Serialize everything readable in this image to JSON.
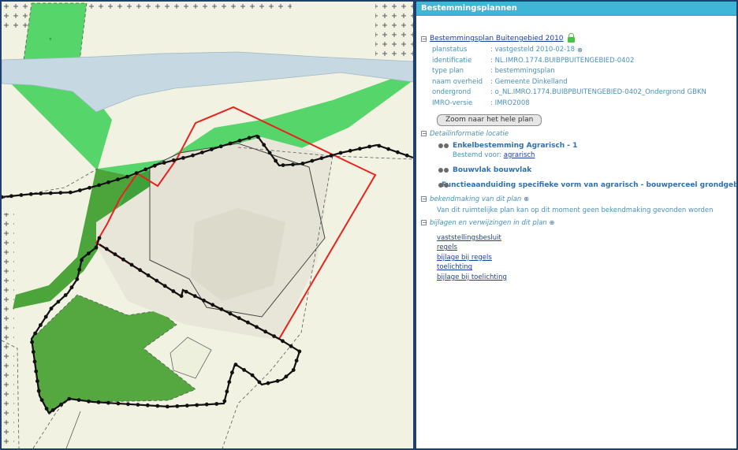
{
  "panel": {
    "header": "Bestemmingsplannen",
    "plan_title": "Bestemmingsplan Buitengebied 2010",
    "fields": [
      {
        "key": "planstatus",
        "value": ": vastgesteld 2010-02-18"
      },
      {
        "key": "identificatie",
        "value": ": NL.IMRO.1774.BUIBPBUITENGEBIED-0402"
      },
      {
        "key": "type plan",
        "value": ": bestemmingsplan"
      },
      {
        "key": "naam overheid",
        "value": ": Gemeente Dinkelland"
      },
      {
        "key": "ondergrond",
        "value": ": o_NL.IMRO.1774.BUIBPBUITENGEBIED-0402_Ondergrond GBKN"
      },
      {
        "key": "IMRO-versie",
        "value": ": IMRO2008"
      }
    ],
    "zoom_button": "Zoom naar het hele plan",
    "detail_head": "Detailinformatie locatie",
    "detail_items": [
      {
        "label": "Enkelbestemming Agrarisch - 1"
      },
      {
        "label": "Bouwvlak bouwvlak"
      },
      {
        "label": "Functieaanduiding specifieke vorm van agrarisch - bouwperceel grondgebonden"
      }
    ],
    "bestemd_label": "Bestemd voor:",
    "bestemd_link": "agrarisch",
    "bekendmaking_head": "bekendmaking van dit plan",
    "bekendmaking_text": "Van dit ruimtelijke plan kan op dit moment geen bekendmaking gevonden worden",
    "bijlagen_head": "bijlagen en verwijzingen in dit plan",
    "links": [
      "vaststellingsbesluit",
      "regels",
      "bijlage bij regels",
      "toelichting",
      "bijlage bij toelichting"
    ],
    "colors": {
      "header": "#3fb6d6",
      "info": "#4a90b8",
      "link": "#1b3f9e"
    }
  },
  "map": {
    "colors": {
      "background": "#f1f2e2",
      "water": "#c9dbe4",
      "forest": "#56d56a",
      "dark_green": "#4da93f",
      "building": "#e6e6da",
      "plan_outline": "#e8231e",
      "parcel_outline": "#111111"
    },
    "icons": [
      "cross-hatch-pattern",
      "grass-symbol"
    ]
  }
}
